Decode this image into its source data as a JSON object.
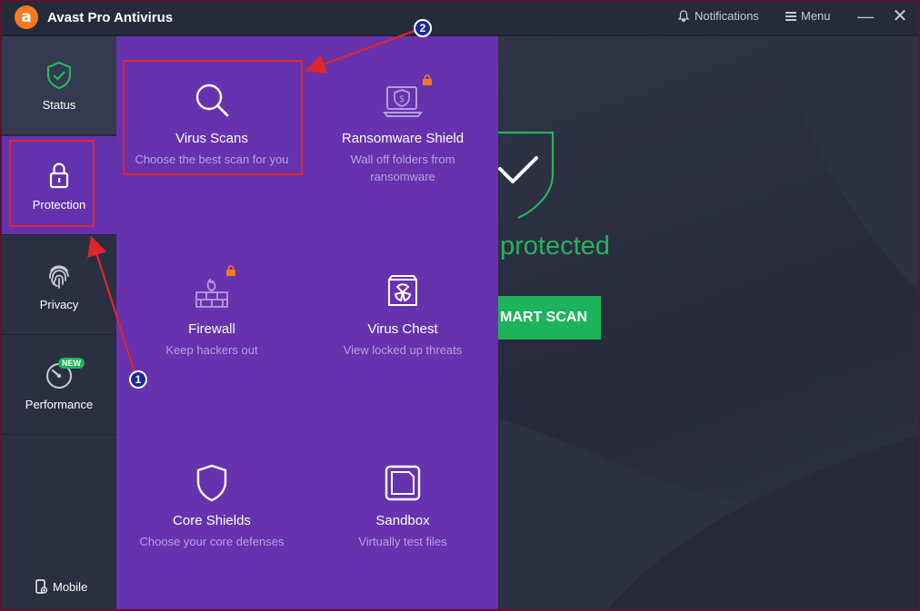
{
  "window": {
    "title": "Avast Pro Antivirus",
    "logo_letter": "a",
    "notifications_label": "Notifications",
    "menu_label": "Menu",
    "minimize_glyph": "—",
    "close_glyph": "✕"
  },
  "sidebar": {
    "items": [
      {
        "label": "Status",
        "icon": "shield-check-icon"
      },
      {
        "label": "Protection",
        "icon": "lock-icon"
      },
      {
        "label": "Privacy",
        "icon": "fingerprint-icon"
      },
      {
        "label": "Performance",
        "icon": "speedometer-icon"
      }
    ],
    "badge_new": "NEW",
    "mobile_label": "Mobile"
  },
  "protection_panel": {
    "tiles": [
      {
        "title": "Virus Scans",
        "subtitle": "Choose the best scan for you",
        "icon": "magnifier-icon"
      },
      {
        "title": "Ransomware Shield",
        "subtitle": "Wall off folders from ransomware",
        "icon": "ransomware-shield-icon",
        "locked": true
      },
      {
        "title": "Firewall",
        "subtitle": "Keep hackers out",
        "icon": "firewall-icon",
        "locked": true
      },
      {
        "title": "Virus Chest",
        "subtitle": "View locked up threats",
        "icon": "virus-chest-icon"
      },
      {
        "title": "Core Shields",
        "subtitle": "Choose your core defenses",
        "icon": "core-shield-icon"
      },
      {
        "title": "Sandbox",
        "subtitle": "Virtually test files",
        "icon": "sandbox-icon"
      }
    ]
  },
  "main": {
    "status_text": "protected",
    "smart_scan_label": "MART SCAN"
  },
  "annotations": {
    "step1": "1",
    "step2": "2"
  },
  "colors": {
    "accent_purple": "#6632ad",
    "accent_green": "#1db35b",
    "avast_orange": "#f47a20",
    "annotation_red": "#e0262b"
  }
}
